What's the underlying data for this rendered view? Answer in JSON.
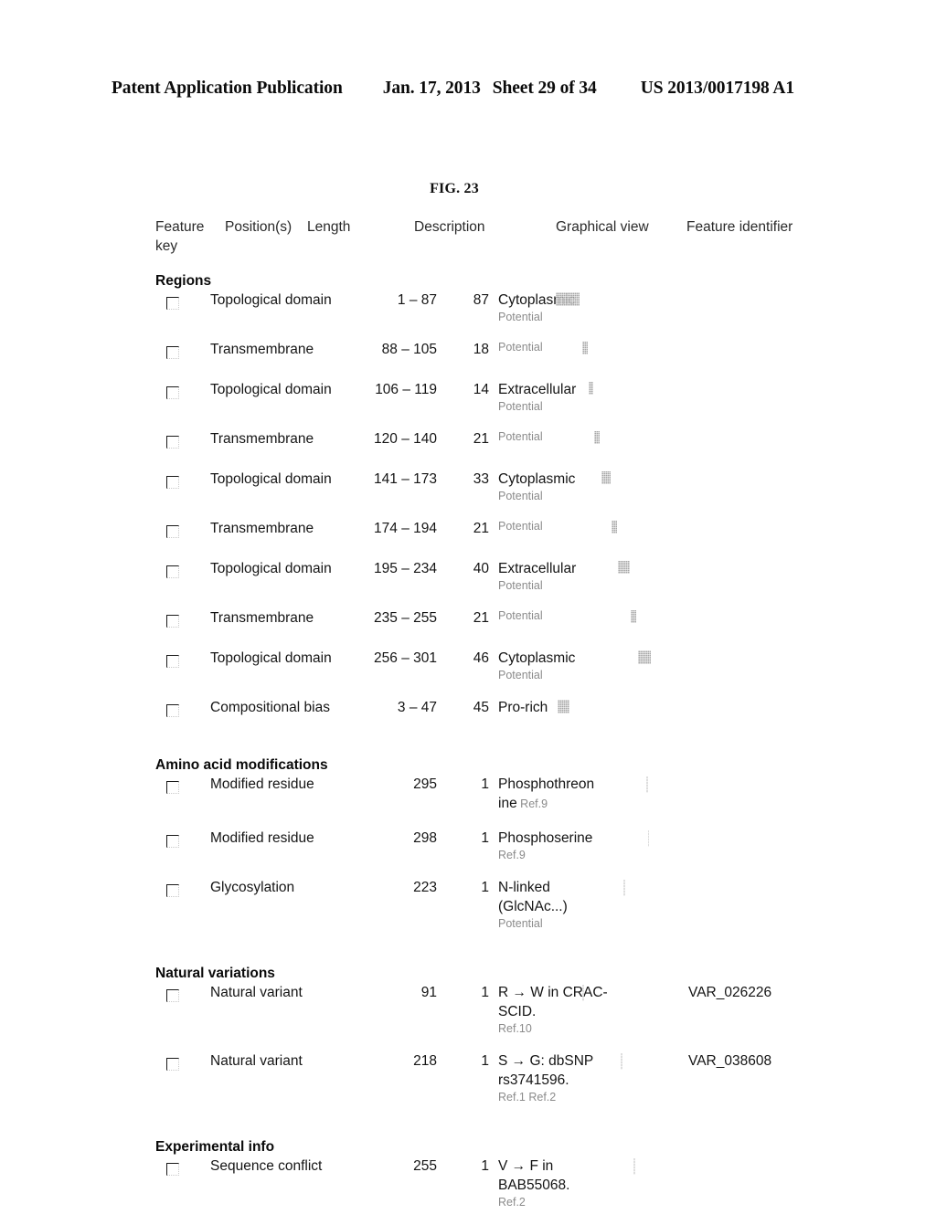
{
  "page_header": {
    "publication": "Patent Application Publication",
    "date": "Jan. 17, 2013",
    "sheet": "Sheet 29 of 34",
    "patent_number": "US 2013/0017198 A1"
  },
  "figure": {
    "caption": "FIG. 23"
  },
  "table": {
    "columns": {
      "feature_key": "Feature key",
      "positions": "Position(s)",
      "length": "Length",
      "description": "Description",
      "graphical_view": "Graphical view",
      "feature_identifier": "Feature identifier"
    },
    "sections": [
      {
        "heading": "Regions",
        "rows": [
          {
            "key_checkbox": "checkbox-unchecked",
            "feature": "Topological domain",
            "positions": "1 – 87",
            "length": "87",
            "description": "Cytoplasmic",
            "description_note": "Potential",
            "graphic": {
              "left_pct": 0,
              "width_pct": 17,
              "style": "solid"
            },
            "identifier": ""
          },
          {
            "key_checkbox": "checkbox-unchecked",
            "feature": "Transmembrane",
            "positions": "88 – 105",
            "length": "18",
            "description": "",
            "description_note": "Potential",
            "graphic": {
              "left_pct": 19,
              "width_pct": 3.5,
              "style": "solid"
            },
            "identifier": ""
          },
          {
            "key_checkbox": "checkbox-unchecked",
            "feature": "Topological domain",
            "positions": "106 – 119",
            "length": "14",
            "description": "Extracellular",
            "description_note": "Potential",
            "graphic": {
              "left_pct": 23.5,
              "width_pct": 3,
              "style": "solid"
            },
            "identifier": ""
          },
          {
            "key_checkbox": "checkbox-unchecked",
            "feature": "Transmembrane",
            "positions": "120 – 140",
            "length": "21",
            "description": "",
            "description_note": "Potential",
            "graphic": {
              "left_pct": 27,
              "width_pct": 4,
              "style": "solid"
            },
            "identifier": ""
          },
          {
            "key_checkbox": "checkbox-unchecked",
            "feature": "Topological domain",
            "positions": "141 – 173",
            "length": "33",
            "description": "Cytoplasmic",
            "description_note": "Potential",
            "graphic": {
              "left_pct": 32,
              "width_pct": 6.5,
              "style": "solid"
            },
            "identifier": ""
          },
          {
            "key_checkbox": "checkbox-unchecked",
            "feature": "Transmembrane",
            "positions": "174 – 194",
            "length": "21",
            "description": "",
            "description_note": "Potential",
            "graphic": {
              "left_pct": 39.5,
              "width_pct": 4,
              "style": "solid"
            },
            "identifier": ""
          },
          {
            "key_checkbox": "checkbox-unchecked",
            "feature": "Topological domain",
            "positions": "195 – 234",
            "length": "40",
            "description": "Extracellular",
            "description_note": "Potential",
            "graphic": {
              "left_pct": 44,
              "width_pct": 8,
              "style": "solid"
            },
            "identifier": ""
          },
          {
            "key_checkbox": "checkbox-unchecked",
            "feature": "Transmembrane",
            "positions": "235 – 255",
            "length": "21",
            "description": "",
            "description_note": "Potential",
            "graphic": {
              "left_pct": 53,
              "width_pct": 4,
              "style": "solid"
            },
            "identifier": ""
          },
          {
            "key_checkbox": "checkbox-unchecked",
            "feature": "Topological domain",
            "positions": "256 – 301",
            "length": "46",
            "description": "Cytoplasmic",
            "description_note": "Potential",
            "graphic": {
              "left_pct": 58,
              "width_pct": 9,
              "style": "solid"
            },
            "identifier": ""
          },
          {
            "key_checkbox": "checkbox-unchecked",
            "feature": "Compositional bias",
            "positions": "3 – 47",
            "length": "45",
            "description": "Pro-rich",
            "description_note": "",
            "graphic": {
              "left_pct": 1,
              "width_pct": 9,
              "style": "solid"
            },
            "identifier": ""
          }
        ]
      },
      {
        "heading": "Amino acid modifications",
        "rows": [
          {
            "key_checkbox": "checkbox-unchecked",
            "feature": "Modified residue",
            "positions": "295",
            "length": "1",
            "description": "Phosphothreon ine",
            "description_inline_note": "Ref.9",
            "description_note": "",
            "graphic": {
              "left_pct": 64,
              "width_pct": 0.9,
              "style": "faint"
            },
            "identifier": ""
          },
          {
            "key_checkbox": "checkbox-unchecked",
            "feature": "Modified residue",
            "positions": "298",
            "length": "1",
            "description": "Phosphoserine",
            "description_note": "Ref.9",
            "graphic": {
              "left_pct": 65,
              "width_pct": 0.9,
              "style": "faint"
            },
            "identifier": ""
          },
          {
            "key_checkbox": "checkbox-unchecked",
            "feature": "Glycosylation",
            "positions": "223",
            "length": "1",
            "description": "N-linked (GlcNAc...)",
            "description_note": "Potential",
            "graphic": {
              "left_pct": 48,
              "width_pct": 0.9,
              "style": "faint"
            },
            "identifier": ""
          }
        ]
      },
      {
        "heading": "Natural variations",
        "rows": [
          {
            "key_checkbox": "checkbox-unchecked",
            "feature": "Natural variant",
            "positions": "91",
            "length": "1",
            "description": "R → W in CRAC-SCID.",
            "description_note": "Ref.10",
            "graphic": {
              "left_pct": 19,
              "width_pct": 0.9,
              "style": "faint"
            },
            "identifier": "VAR_026226"
          },
          {
            "key_checkbox": "checkbox-unchecked",
            "feature": "Natural variant",
            "positions": "218",
            "length": "1",
            "description": "S → G: dbSNP rs3741596.",
            "description_note": "Ref.1 Ref.2",
            "graphic": {
              "left_pct": 46,
              "width_pct": 0.9,
              "style": "faint"
            },
            "identifier": "VAR_038608"
          }
        ]
      },
      {
        "heading": "Experimental info",
        "rows": [
          {
            "key_checkbox": "checkbox-unchecked",
            "feature": "Sequence conflict",
            "positions": "255",
            "length": "1",
            "description": "V → F in BAB55068.",
            "description_note": "Ref.2",
            "graphic": {
              "left_pct": 55,
              "width_pct": 0.9,
              "style": "faint"
            },
            "identifier": ""
          }
        ]
      }
    ]
  }
}
